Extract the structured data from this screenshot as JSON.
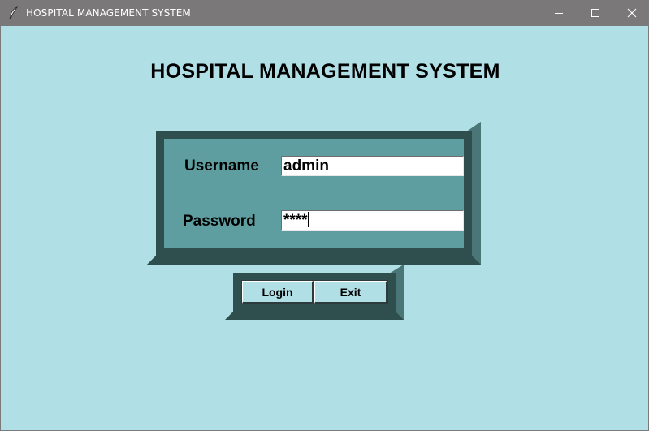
{
  "window": {
    "title": "HOSPITAL MANAGEMENT SYSTEM",
    "icon": "feather-icon",
    "controls": [
      "minimize-icon",
      "maximize-icon",
      "close-icon"
    ]
  },
  "main": {
    "heading": "HOSPITAL MANAGEMENT SYSTEM"
  },
  "login_form": {
    "username_label": "Username",
    "username_value": "admin",
    "password_label": "Password",
    "password_value": "****"
  },
  "buttons": {
    "login_label": "Login",
    "exit_label": "Exit"
  },
  "colors": {
    "background": "#b0dfe5",
    "frame_fill": "#5f9ea0",
    "frame_border": "#2f4f4f",
    "titlebar": "#7a7878"
  }
}
